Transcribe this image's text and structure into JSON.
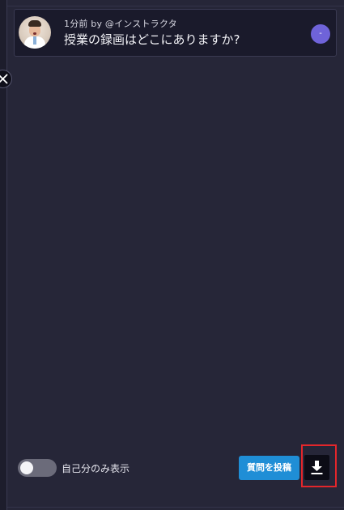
{
  "question": {
    "meta": "1分前 by @インストラクタ",
    "text": "授業の録画はどこにありますか?",
    "vote_label": "-"
  },
  "controls": {
    "toggle_label": "自己分のみ表示",
    "toggle_on": false,
    "post_button_label": "質問を投稿"
  },
  "icons": {
    "close": "close-icon",
    "download": "download-icon",
    "avatar": "instructor-avatar"
  },
  "colors": {
    "accent_purple": "#6f63d9",
    "primary_blue": "#1f8ed6",
    "highlight_red": "#e3262b"
  }
}
